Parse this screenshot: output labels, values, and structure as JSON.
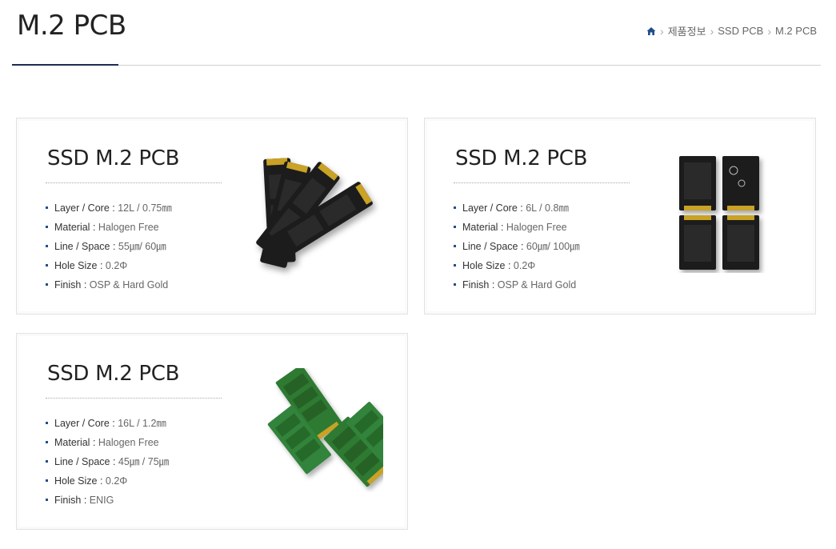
{
  "header": {
    "title": "M.2 PCB",
    "breadcrumb": {
      "home_icon": "home-icon",
      "items": [
        "제품정보",
        "SSD PCB",
        "M.2 PCB"
      ]
    }
  },
  "colors": {
    "accent": "#1f2b50",
    "bullet": "#1f4f8a",
    "pcb_black": "#1c1c1c",
    "pcb_green": "#2f7a32",
    "gold": "#c9a227"
  },
  "products": [
    {
      "title": "SSD M.2 PCB",
      "image": "black-m2-pcb-fan",
      "specs": [
        {
          "label": "Layer / Core",
          "value": "12L / 0.75㎜"
        },
        {
          "label": "Material",
          "value": "Halogen Free"
        },
        {
          "label": "Line / Space",
          "value": "55㎛/ 60㎛"
        },
        {
          "label": "Hole Size",
          "value": "0.2Φ"
        },
        {
          "label": "Finish",
          "value": "OSP & Hard Gold"
        }
      ]
    },
    {
      "title": "SSD M.2 PCB",
      "image": "black-m2-pcb-quad",
      "specs": [
        {
          "label": "Layer / Core",
          "value": "6L / 0.8㎜"
        },
        {
          "label": "Material",
          "value": "Halogen Free"
        },
        {
          "label": "Line / Space",
          "value": "60㎛/ 100㎛"
        },
        {
          "label": "Hole Size",
          "value": "0.2Φ"
        },
        {
          "label": "Finish",
          "value": "OSP & Hard Gold"
        }
      ]
    },
    {
      "title": "SSD M.2 PCB",
      "image": "green-m2-pcb-stack",
      "specs": [
        {
          "label": "Layer / Core",
          "value": "16L / 1.2㎜"
        },
        {
          "label": "Material",
          "value": "Halogen Free"
        },
        {
          "label": "Line / Space",
          "value": "45㎛ / 75㎛"
        },
        {
          "label": "Hole Size",
          "value": "0.2Φ"
        },
        {
          "label": "Finish",
          "value": "ENIG"
        }
      ]
    }
  ]
}
